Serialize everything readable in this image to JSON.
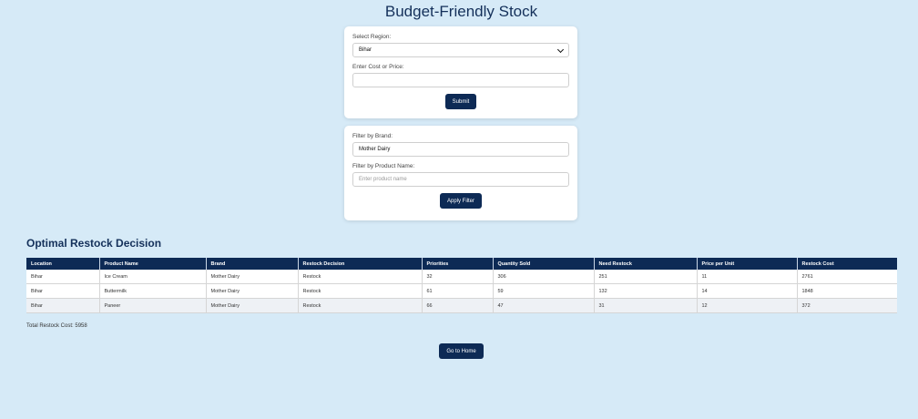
{
  "page": {
    "title": "Budget-Friendly Stock"
  },
  "region_form": {
    "region_label": "Select Region:",
    "region_value": "Bihar",
    "price_label": "Enter Cost or Price:",
    "price_value": "",
    "submit_label": "Submit"
  },
  "filter_form": {
    "brand_label": "Filter by Brand:",
    "brand_value": "Mother Dairy",
    "product_label": "Filter by Product Name:",
    "product_placeholder": "Enter product name",
    "apply_label": "Apply Filter"
  },
  "results": {
    "title": "Optimal Restock Decision",
    "columns": [
      "Location",
      "Product Name",
      "Brand",
      "Restock Decision",
      "Priorities",
      "Quantity Sold",
      "Need Restock",
      "Price per Unit",
      "Restock Cost"
    ],
    "rows": [
      [
        "Bihar",
        "Ice Cream",
        "Mother Dairy",
        "Restock",
        "32",
        "306",
        "251",
        "11",
        "2761"
      ],
      [
        "Bihar",
        "Buttermilk",
        "Mother Dairy",
        "Restock",
        "61",
        "59",
        "132",
        "14",
        "1848"
      ],
      [
        "Bihar",
        "Paneer",
        "Mother Dairy",
        "Restock",
        "66",
        "47",
        "31",
        "12",
        "372"
      ]
    ],
    "total_label": "Total Restock Cost: 5958"
  },
  "home_button": {
    "label": "Go to Home"
  }
}
